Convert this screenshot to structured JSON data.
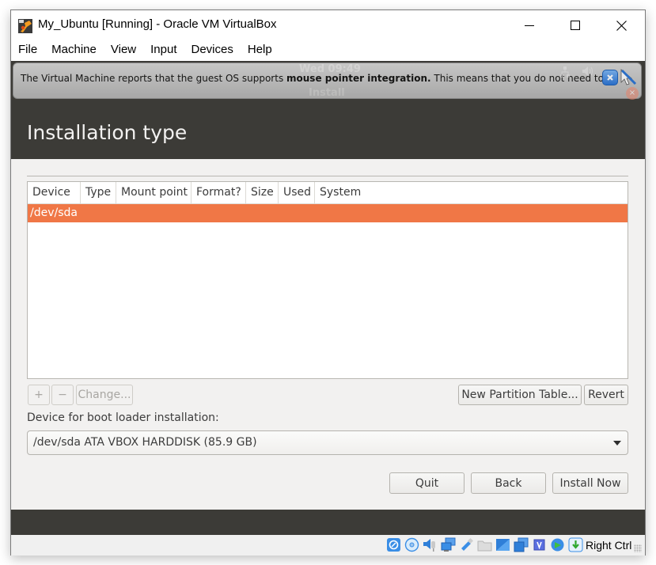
{
  "window": {
    "title": "My_Ubuntu [Running] - Oracle VM VirtualBox",
    "controls": {
      "minimize": "minimize-icon",
      "maximize": "maximize-icon",
      "close": "close-icon"
    }
  },
  "menubar": {
    "items": [
      "File",
      "Machine",
      "View",
      "Input",
      "Devices",
      "Help"
    ]
  },
  "guest": {
    "topbar": {
      "clock": "Wed 09:49",
      "window_name": "Install"
    },
    "notification": {
      "text_before": "The Virtual Machine reports that the guest OS supports ",
      "text_bold": "mouse pointer integration.",
      "text_after": " This means that you do not need to"
    },
    "page_title": "Installation type",
    "partition_table": {
      "columns": [
        "Device",
        "Type",
        "Mount point",
        "Format?",
        "Size",
        "Used",
        "System"
      ],
      "rows": [
        {
          "device": "/dev/sda",
          "type": "",
          "mount_point": "",
          "format": "",
          "size": "",
          "used": "",
          "system": "",
          "selected": true
        }
      ]
    },
    "buttons": {
      "add": "+",
      "remove": "−",
      "change": "Change...",
      "new_partition_table": "New Partition Table...",
      "revert": "Revert",
      "quit": "Quit",
      "back": "Back",
      "install_now": "Install Now"
    },
    "boot_loader": {
      "label": "Device for boot loader installation:",
      "selected": "/dev/sda ATA VBOX HARDDISK (85.9 GB)"
    },
    "colors": {
      "accent": "#f07746",
      "header_bg": "#3c3b37",
      "body_bg": "#f2f1f0"
    }
  },
  "statusbar": {
    "icons": [
      "hard-disk-icon",
      "optical-drive-icon",
      "audio-icon",
      "network-icon",
      "usb-icon",
      "shared-folders-icon",
      "display-icon",
      "video-capture-icon",
      "cpu-icon",
      "remote-display-icon",
      "mouse-integration-icon"
    ],
    "host_key": "Right Ctrl"
  }
}
